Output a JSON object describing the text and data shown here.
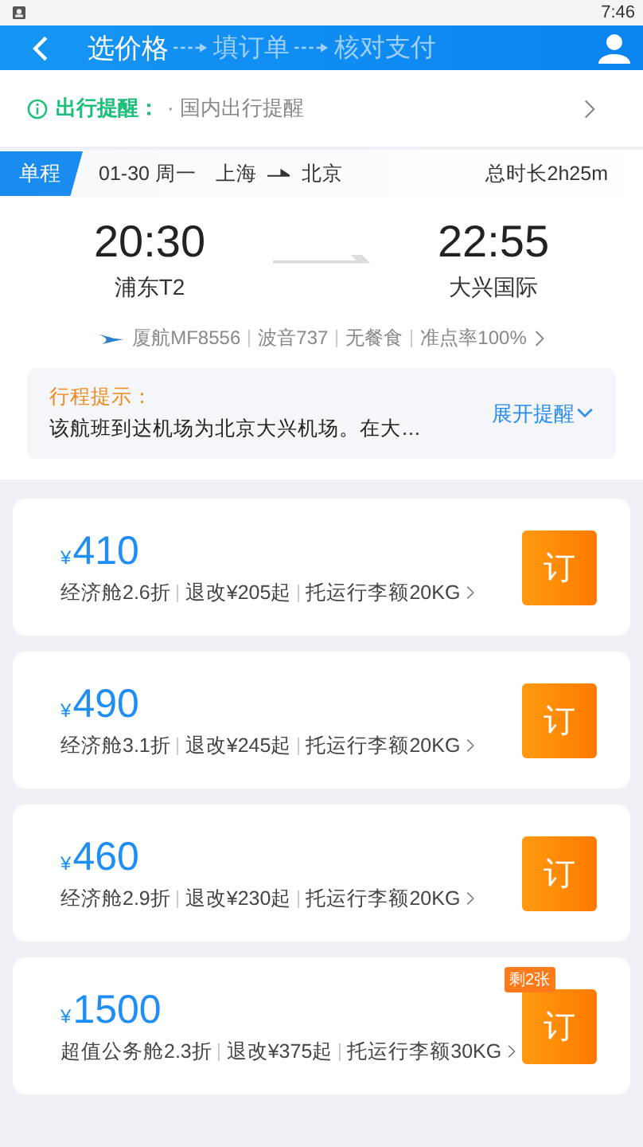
{
  "status_bar": {
    "time": "7:46"
  },
  "header": {
    "steps": [
      {
        "label": "选价格",
        "selected": true
      },
      {
        "label": "填订单",
        "selected": false
      },
      {
        "label": "核对支付",
        "selected": false
      }
    ]
  },
  "reminder": {
    "label": "出行提醒：",
    "text": "· 国内出行提醒"
  },
  "trip": {
    "tag": "单程",
    "date": "01-30 周一",
    "from_city": "上海",
    "to_city": "北京",
    "duration": "总时长2h25m",
    "depart_time": "20:30",
    "depart_airport": "浦东T2",
    "arrive_time": "22:55",
    "arrive_airport": "大兴国际",
    "info": [
      "厦航MF8556",
      "波音737",
      "无餐食",
      "准点率100%"
    ]
  },
  "tip": {
    "title": "行程提示：",
    "text": "该航班到达机场为北京大兴机场。在大…",
    "toggle": "展开提醒"
  },
  "fares": [
    {
      "currency": "¥",
      "price": "410",
      "details": [
        "经济舱2.6折",
        "退改¥205起",
        "托运行李额20KG"
      ],
      "button": "订"
    },
    {
      "currency": "¥",
      "price": "490",
      "details": [
        "经济舱3.1折",
        "退改¥245起",
        "托运行李额20KG"
      ],
      "button": "订"
    },
    {
      "currency": "¥",
      "price": "460",
      "details": [
        "经济舱2.9折",
        "退改¥230起",
        "托运行李额20KG"
      ],
      "button": "订"
    },
    {
      "currency": "¥",
      "price": "1500",
      "details": [
        "超值公务舱2.3折",
        "退改¥375起",
        "托运行李额30KG"
      ],
      "button": "订",
      "badge": "剩2张"
    }
  ]
}
